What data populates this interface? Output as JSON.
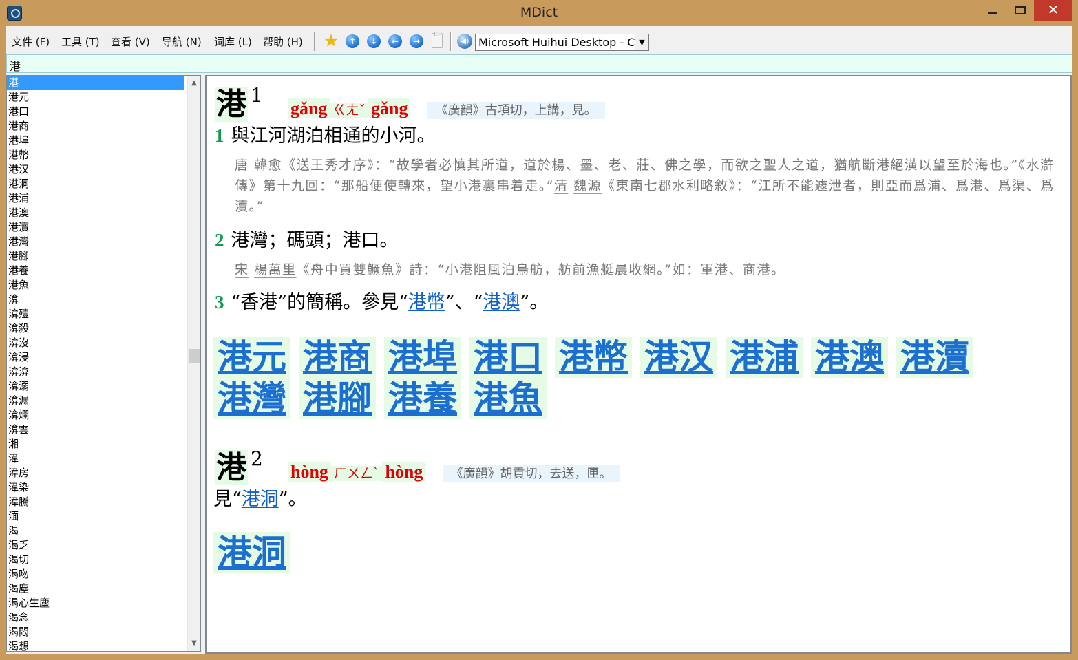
{
  "window": {
    "title": "MDict",
    "minimize": "—",
    "close": "✕"
  },
  "menu": [
    {
      "label": "文件 (F)"
    },
    {
      "label": "工具 (T)"
    },
    {
      "label": "查看 (V)"
    },
    {
      "label": "导航 (N)"
    },
    {
      "label": "词库 (L)"
    },
    {
      "label": "帮助 (H)"
    }
  ],
  "toolbar": {
    "icons": [
      "favorite-star-icon",
      "nav-up-icon",
      "nav-down-icon",
      "nav-back-icon",
      "nav-forward-icon",
      "paste-icon",
      "speaker-icon"
    ],
    "dictionary_selected": "Microsoft Huihui Desktop - Cl"
  },
  "search": {
    "value": "港"
  },
  "wordlist": [
    "港",
    "港元",
    "港口",
    "港商",
    "港埠",
    "港幣",
    "港汉",
    "港洞",
    "港浦",
    "港澳",
    "港瀆",
    "港灣",
    "港腳",
    "港養",
    "港魚",
    "渰",
    "渰殪",
    "渰殺",
    "渰沒",
    "渰浸",
    "渰渰",
    "渰溺",
    "渰漏",
    "渰爛",
    "渰雲",
    "湘",
    "湋",
    "湋房",
    "湋染",
    "湋騰",
    "湎",
    "渴",
    "渴乏",
    "渴切",
    "渴吻",
    "渴塵",
    "渴心生塵",
    "渴念",
    "渴悶",
    "渴想"
  ],
  "entry1": {
    "headword": "港",
    "num": "1",
    "pinyin": "gǎng",
    "zhuyin": "ㄍㄤˇ",
    "pinyin2": "gǎng",
    "rhyme": "《廣韻》古項切，上講，見。",
    "defs": [
      {
        "num": "1",
        "text": "與江河湖泊相通的小河。"
      },
      {
        "num": "2",
        "text": "港灣；碼頭；港口。"
      },
      {
        "num": "3",
        "text_a": "“香港”的簡稱。參見“",
        "link1": "港幣",
        "text_b": "”、“",
        "link2": "港澳",
        "text_c": "”。"
      }
    ],
    "ex1": {
      "p1": "唐",
      "p2": "韓愈",
      "t1": "《送王秀才序》：“故學者必慎其所道，道於",
      "p3": "楊",
      "t2": "、",
      "p4": "墨",
      "t3": "、",
      "p5": "老",
      "t4": "、",
      "p6": "莊",
      "t5": "、佛之學，而欲之聖人之道，猶航斷港絕潢以望至於海也。”《水滸傳》第十九回：“那船便使轉來，望小港裏串着走。”",
      "p7": "清",
      "p8": "魏源",
      "t6": "《東南七郡水利略敘》：“江所不能遽泄者，則亞而爲浦、爲港、爲渠、爲瀆。”"
    },
    "ex2": {
      "p1": "宋",
      "p2": "楊萬里",
      "t1": "《舟中買雙鱖魚》詩：“小港阻風泊烏舫，舫前漁艇晨收網。”如：軍港、商港。"
    },
    "related": [
      "港元",
      "港商",
      "港埠",
      "港口",
      "港幣",
      "港汉",
      "港浦",
      "港澳",
      "港瀆",
      "港灣",
      "港腳",
      "港養",
      "港魚"
    ]
  },
  "entry2": {
    "headword": "港",
    "num": "2",
    "pinyin": "hòng",
    "zhuyin": "ㄏㄨㄥˋ",
    "pinyin2": "hòng",
    "rhyme": "《廣韻》胡貢切，去送，匣。",
    "see_a": "見“",
    "see_link": "港洞",
    "see_b": "”。",
    "related": [
      "港洞"
    ]
  }
}
